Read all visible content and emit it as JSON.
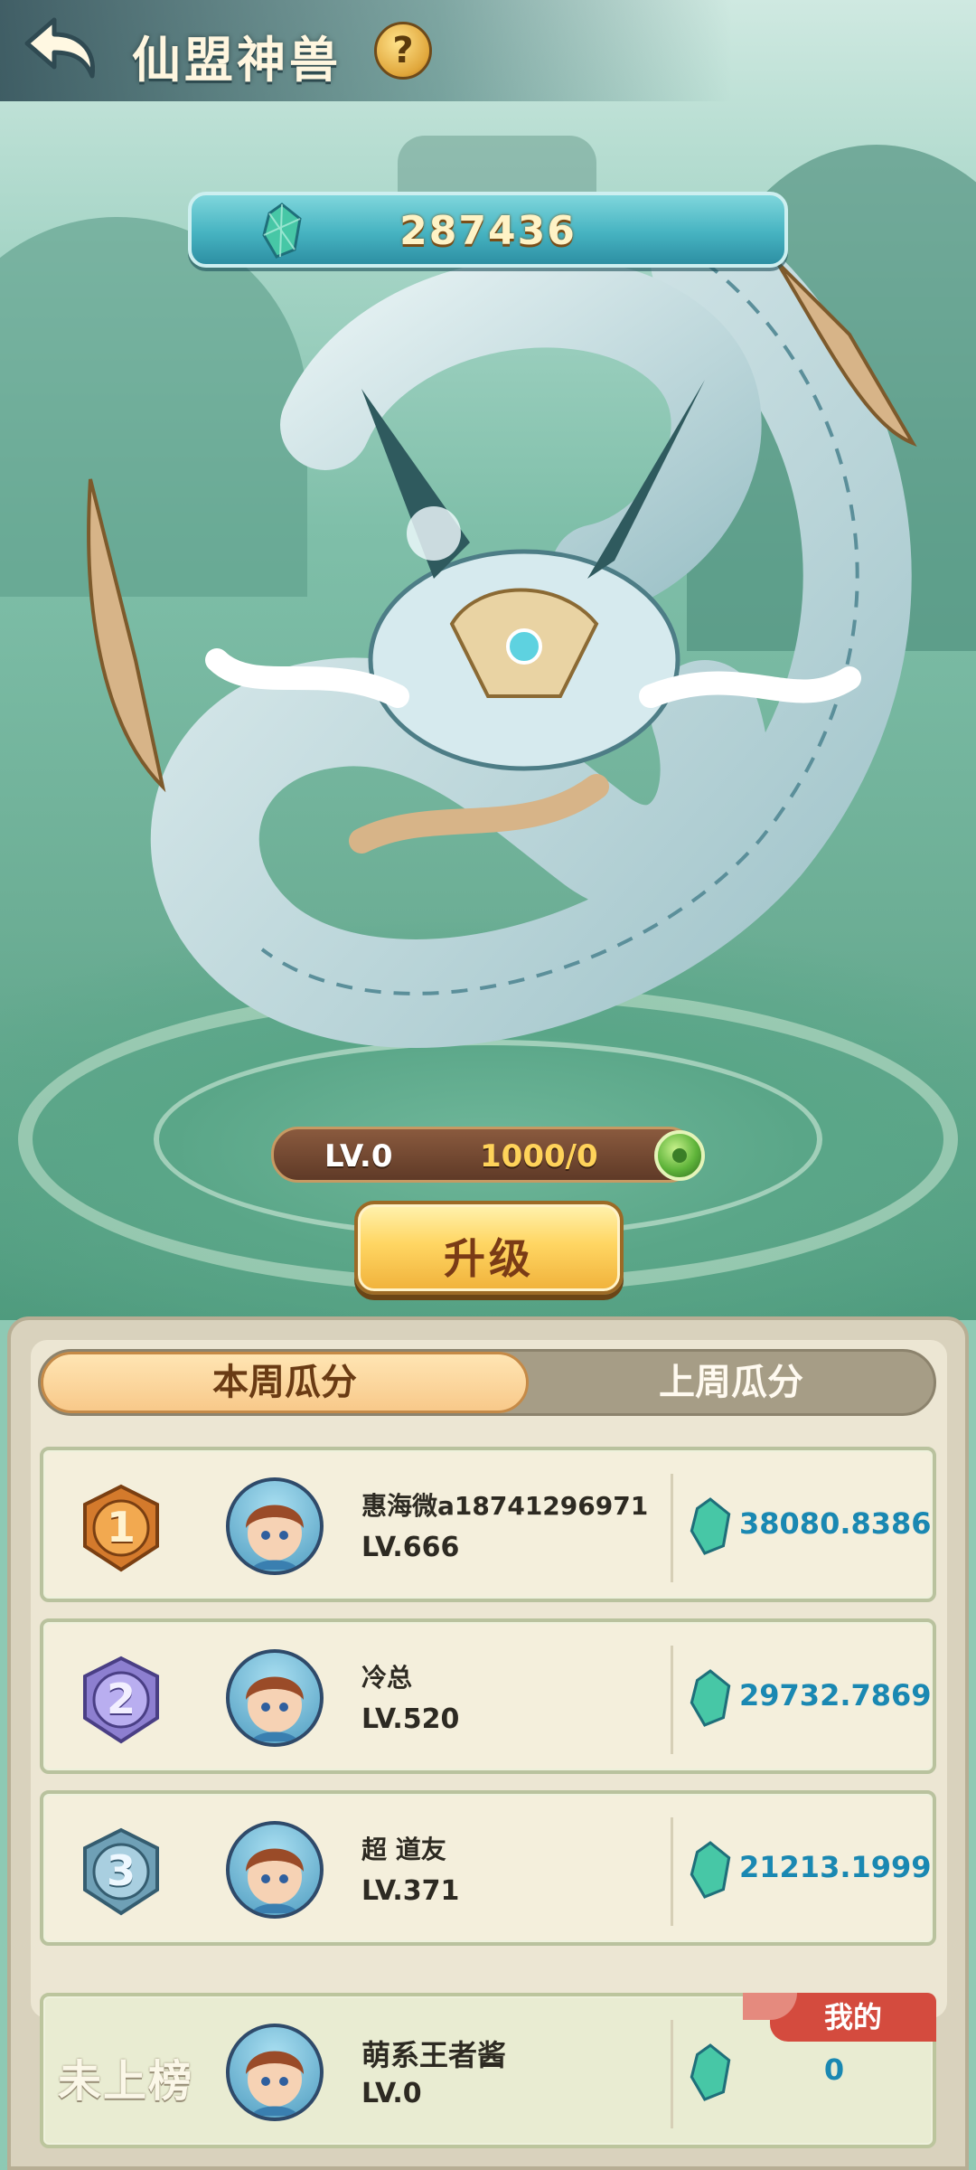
{
  "header": {
    "title": "仙盟神兽",
    "help_label": "?"
  },
  "currency": {
    "value": "287436"
  },
  "beast": {
    "level_label": "LV.0",
    "exp": "1000/0",
    "upgrade_label": "升级"
  },
  "tabs": [
    {
      "label": "本周瓜分",
      "active": true
    },
    {
      "label": "上周瓜分",
      "active": false
    }
  ],
  "ranking": [
    {
      "rank": "1",
      "name": "惠海微a18741296971",
      "level": "LV.666",
      "score": "38080.8386"
    },
    {
      "rank": "2",
      "name": "冷总",
      "level": "LV.520",
      "score": "29732.7869"
    },
    {
      "rank": "3",
      "name": "超 道友",
      "level": "LV.371",
      "score": "21213.1999"
    }
  ],
  "mine": {
    "status": "未上榜",
    "name": "萌系王者酱",
    "level": "LV.0",
    "score": "0",
    "tag": "我的"
  },
  "colors": {
    "rank1": "#d47a2c",
    "rank2": "#8d7fd0",
    "rank3": "#6fa0b6",
    "score": "#1a88b2"
  }
}
